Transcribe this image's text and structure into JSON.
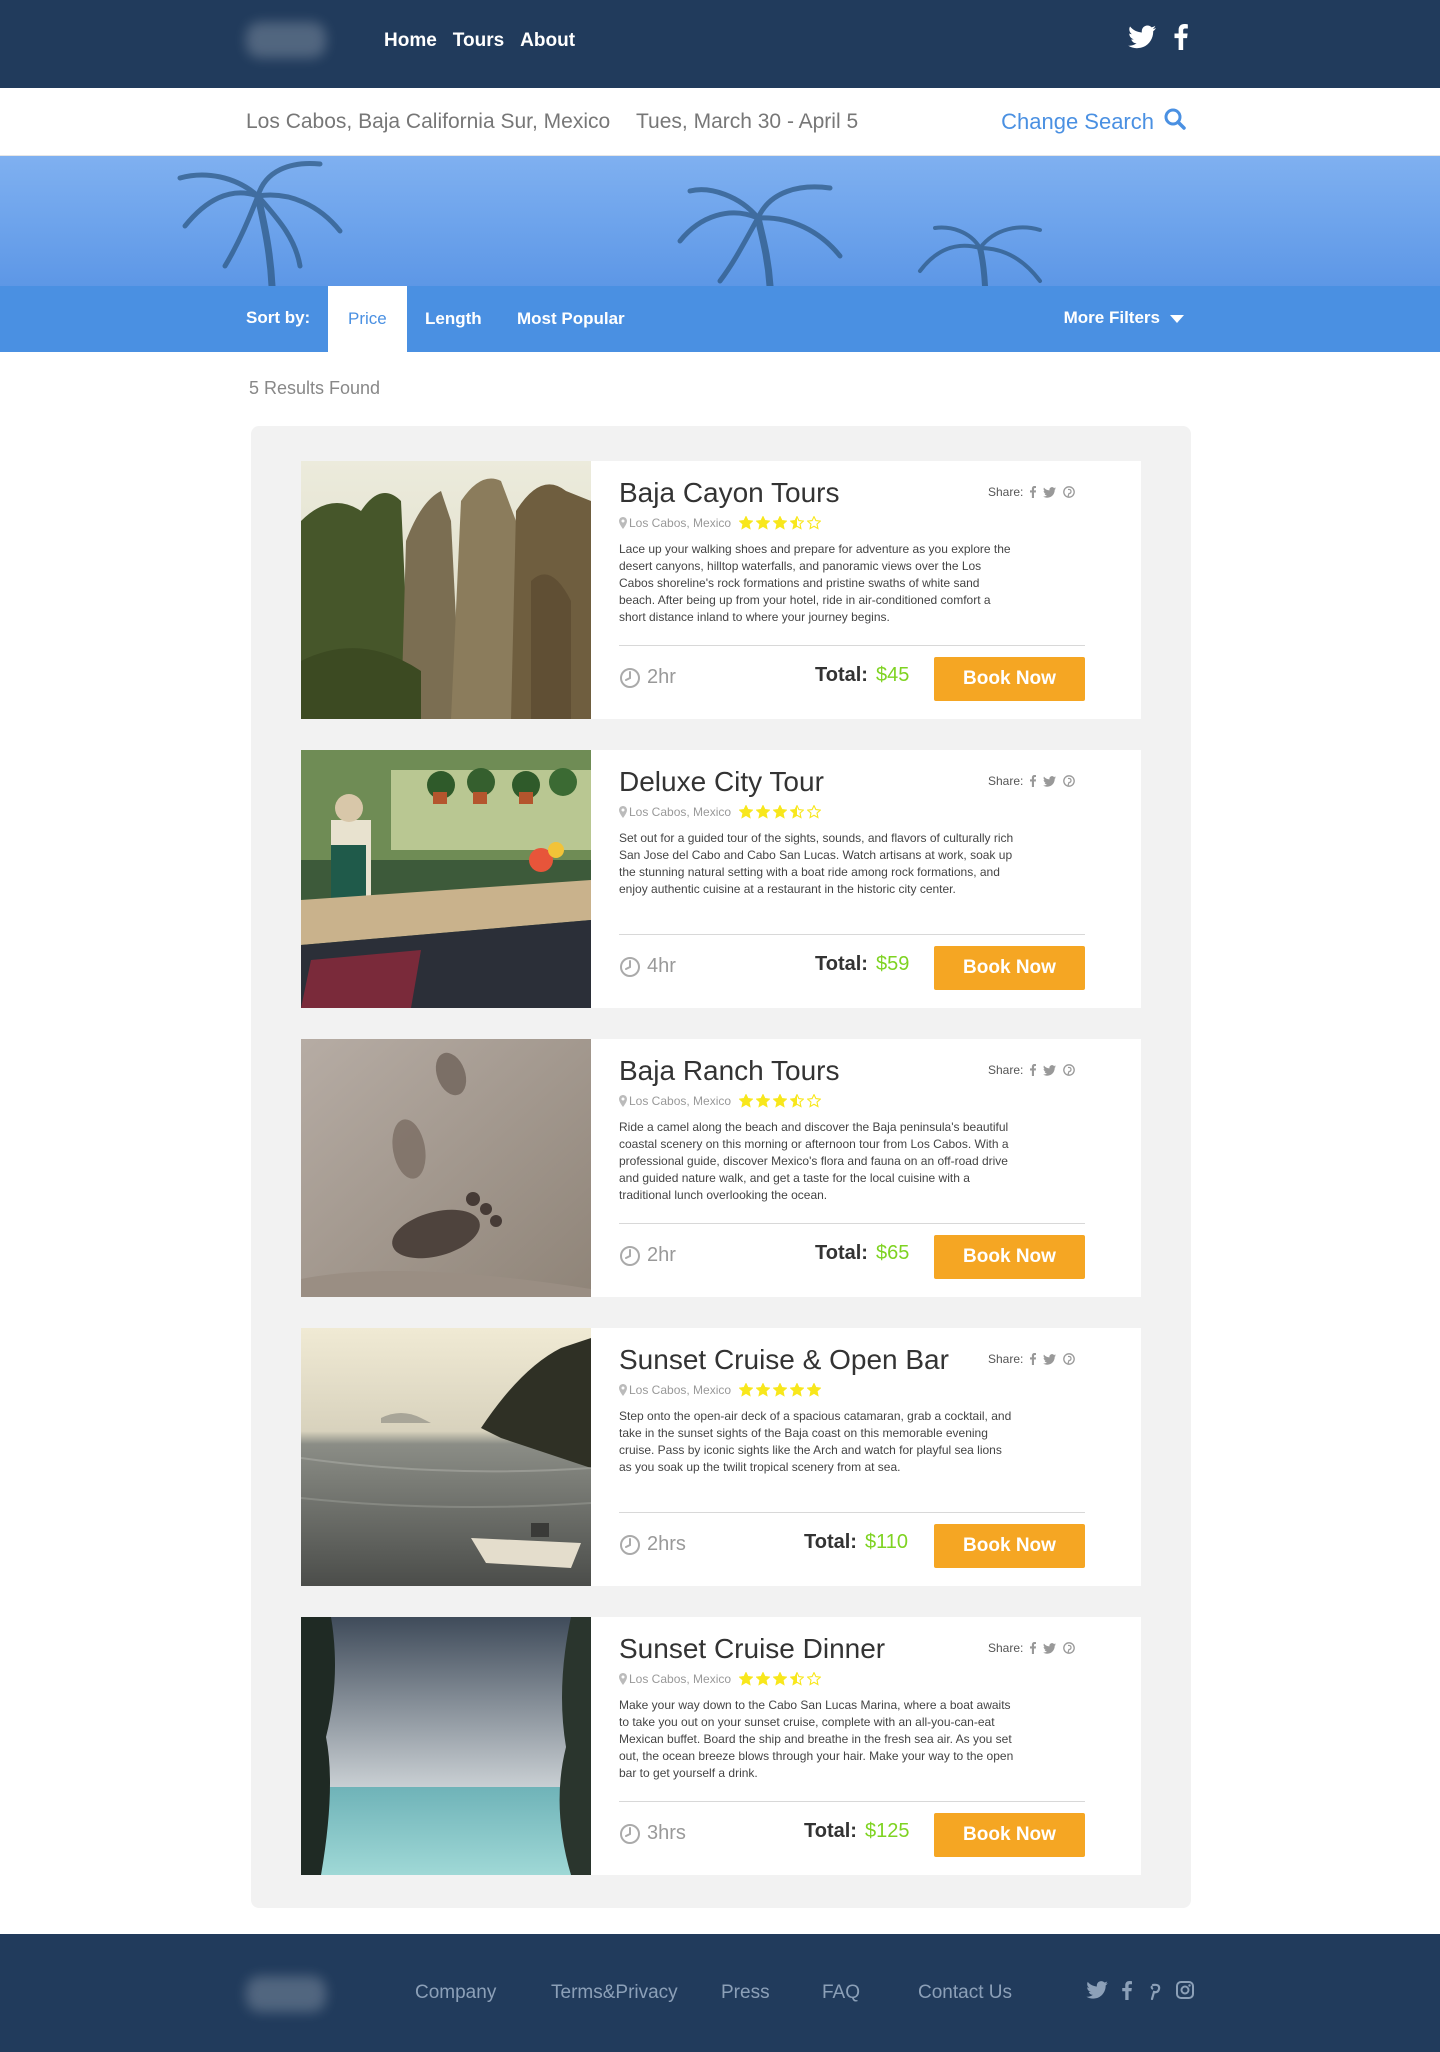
{
  "nav": {
    "links": [
      "Home",
      "Tours",
      "About"
    ],
    "social_icons": [
      "twitter-icon",
      "facebook-icon"
    ]
  },
  "search": {
    "location": "Los Cabos, Baja California Sur, Mexico",
    "dates": "Tues, March 30 - April 5",
    "change_label": "Change Search"
  },
  "sort": {
    "label": "Sort by:",
    "tabs": [
      "Price",
      "Length",
      "Most Popular"
    ],
    "active": "Price",
    "more_filters": "More Filters"
  },
  "results": {
    "count_label": "5 Results Found",
    "share_label": "Share:",
    "total_label": "Total:",
    "book_label": "Book Now",
    "items": [
      {
        "title": "Baja Cayon Tours",
        "location": "Los Cabos, Mexico",
        "rating": 3.5,
        "description": "Lace up your walking shoes and prepare for adventure as you explore the desert canyons, hilltop waterfalls, and panoramic views over the Los Cabos shoreline's rock formations and pristine swaths of white sand beach. After being up from your hotel, ride in air-conditioned comfort a short distance inland to where your journey begins.",
        "duration": "2hr",
        "price": "$45"
      },
      {
        "title": "Deluxe City Tour",
        "location": "Los Cabos, Mexico",
        "rating": 3.5,
        "description": "Set out for a guided tour of the sights, sounds, and flavors of culturally rich San Jose del Cabo and Cabo San Lucas. Watch artisans at work, soak up the stunning natural setting with a boat ride among rock formations, and enjoy authentic cuisine at a restaurant in the historic city center.",
        "duration": "4hr",
        "price": "$59"
      },
      {
        "title": "Baja Ranch Tours",
        "location": "Los Cabos, Mexico",
        "rating": 3.5,
        "description": "Ride a camel along the beach and discover the Baja peninsula's beautiful coastal scenery on this morning or afternoon tour from Los Cabos. With a professional guide, discover Mexico's flora and fauna on an off-road drive and guided nature walk, and get a taste for the local cuisine with a traditional lunch overlooking the ocean.",
        "duration": "2hr",
        "price": "$65"
      },
      {
        "title": "Sunset Cruise & Open Bar",
        "location": "Los Cabos, Mexico",
        "rating": 5,
        "description": "Step onto the open-air deck of a spacious catamaran, grab a cocktail, and take in the sunset sights of the Baja coast on this memorable evening cruise. Pass by iconic sights like the Arch and watch for playful sea lions as you soak up the twilit tropical scenery from at sea.",
        "duration": "2hrs",
        "price": "$110"
      },
      {
        "title": "Sunset Cruise Dinner",
        "location": "Los Cabos, Mexico",
        "rating": 3.5,
        "description": "Make your way down to the Cabo San Lucas Marina, where a boat awaits to take you out on your sunset cruise, complete with an all-you-can-eat Mexican buffet. Board the ship and breathe in the fresh sea air. As you set out, the ocean breeze blows through your hair. Make your way to the open bar to get yourself a drink.",
        "duration": "3hrs",
        "price": "$125"
      }
    ]
  },
  "footer": {
    "links": [
      "Company",
      "Terms&Privacy",
      "Press",
      "FAQ",
      "Contact Us"
    ],
    "social_icons": [
      "twitter-icon",
      "facebook-icon",
      "pinterest-icon",
      "instagram-icon"
    ]
  },
  "colors": {
    "navy": "#213b5c",
    "accent_blue": "#4a90e2",
    "book_orange": "#f5a623",
    "price_green": "#7ed321",
    "star_yellow": "#f8e71c"
  }
}
